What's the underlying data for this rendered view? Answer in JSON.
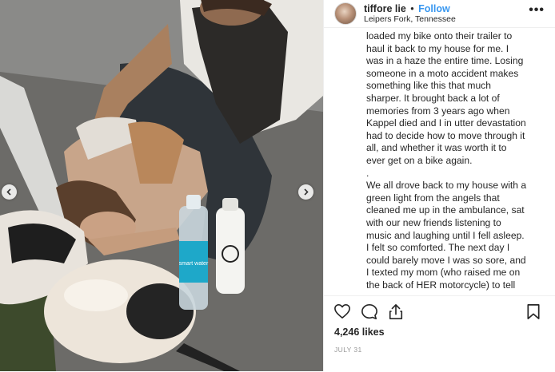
{
  "post": {
    "username": "tiffore lie",
    "follow_separator": "•",
    "follow_label": "Follow",
    "location": "Leipers Fork, Tennessee",
    "more_label": "•••",
    "caption_lines": [
      "loaded my bike onto their trailer to",
      "haul it back to my house for me. I",
      "was in a haze the entire time. Losing",
      "someone in a moto accident makes",
      "something like this that much",
      "sharper. It brought back a lot of",
      "memories from 3 years ago when",
      "Kappel died and I in utter devastation",
      "had to decide how to move through it",
      "all, and whether it was worth it to",
      "ever get on a bike again."
    ],
    "separator": ".",
    "caption_lines_2": [
      "We all drove back to my house with a",
      "green light from the angels that",
      "cleaned me up in the ambulance, sat",
      "with our new friends listening to",
      "music and laughing until I fell asleep.",
      "I felt so comforted. The next day I",
      "could barely move I was so sore, and",
      "I texted my mom (who raised me on",
      "the back of HER motorcycle) to tell"
    ],
    "likes": "4,246 likes",
    "date": "JULY 31"
  },
  "photo": {
    "bottle_label": "smart water"
  },
  "icons": {
    "like": "heart-icon",
    "comment": "comment-icon",
    "share": "share-icon",
    "save": "bookmark-icon",
    "prev": "chevron-left-icon",
    "next": "chevron-right-icon"
  },
  "colors": {
    "follow_blue": "#3897f0",
    "text": "#262626",
    "muted": "#999999",
    "divider": "#efefef"
  }
}
